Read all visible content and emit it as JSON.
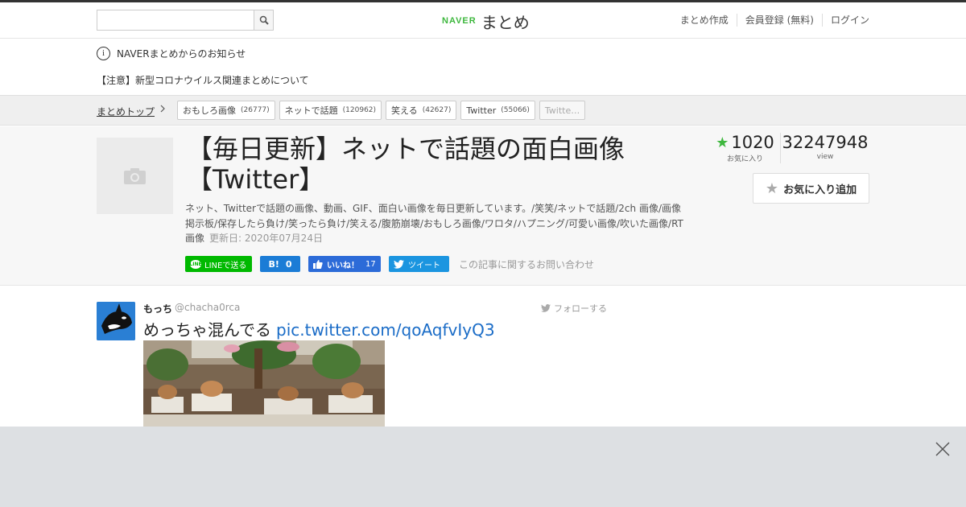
{
  "header": {
    "logo_naver": "NAVER",
    "logo_matome": "まとめ",
    "nav": [
      "まとめ作成",
      "会員登録 (無料)",
      "ログイン"
    ]
  },
  "notice": {
    "title": "NAVERまとめからのお知らせ",
    "link": "【注意】新型コロナウイルス関連まとめについて"
  },
  "breadcrumb": {
    "top": "まとめトップ",
    "tags": [
      {
        "label": "おもしろ画像",
        "count": "(26777)"
      },
      {
        "label": "ネットで話題",
        "count": "(120962)"
      },
      {
        "label": "笑える",
        "count": "(42627)"
      },
      {
        "label": "Twitter",
        "count": "(55066)"
      },
      {
        "label": "Twitte…",
        "count": ""
      }
    ]
  },
  "article": {
    "title_line1": "【毎日更新】ネットで話題の面白画像",
    "title_line2": "【Twitter】",
    "description": "ネット、Twitterで話題の画像、動画、GIF、面白い画像を毎日更新しています。/笑笑/ネットで話題/2ch 画像/画像掲示板/保存したら負け/笑ったら負け/笑える/腹筋崩壊/おもしろ画像/ワロタ/ハプニング/可愛い画像/吹いた画像/RT画像",
    "updated": "更新日: 2020年07月24日",
    "favorites": "1020",
    "favorites_label": "お気に入り",
    "views": "32247948",
    "views_label": "view",
    "fav_button": "お気に入り追加"
  },
  "share": {
    "line": "LINEで送る",
    "line_badge": "LINE",
    "hatena_icon": "B!",
    "hatena_count": "0",
    "fb_label": "いいね！",
    "fb_count": "17",
    "tweet": "ツイート",
    "inquiry": "この記事に関するお問い合わせ"
  },
  "tweet": {
    "name": "もっち",
    "handle": "@chacha0rca",
    "follow": "フォローする",
    "text": "めっちゃ混んでる",
    "link": "pic.twitter.com/qoAqfvIyQ3"
  },
  "icons": [
    "search-icon",
    "info-icon",
    "camera-icon",
    "star-icon",
    "twitter-bird-icon",
    "close-icon",
    "thumbs-up-icon"
  ],
  "colors": {
    "naver_green": "#3db73d",
    "line_green": "#00b900",
    "hatena_blue": "#1b7cd6",
    "fb_blue": "#2c6bd8",
    "twitter_blue": "#1b95e0",
    "link_blue": "#1a6cc7"
  }
}
